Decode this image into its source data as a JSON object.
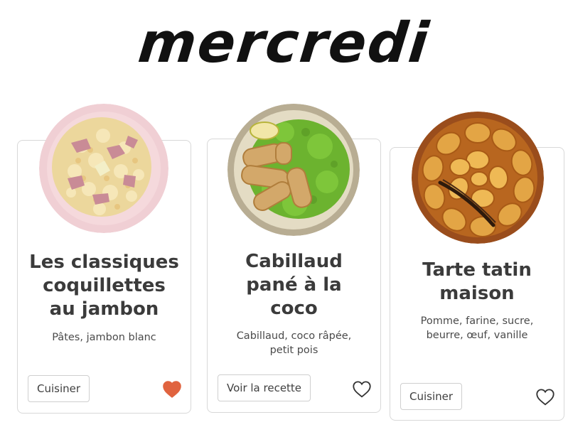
{
  "day": "mercredi",
  "recipes": [
    {
      "title_lines": [
        "Les classiques",
        "coquillettes",
        "au jambon"
      ],
      "ingredients_lines": [
        "Pâtes, jambon blanc"
      ],
      "button_label": "Cuisiner",
      "favorited": true,
      "heart_color": "#e0633f"
    },
    {
      "title_lines": [
        "Cabillaud",
        "pané à la",
        "coco"
      ],
      "ingredients_lines": [
        "Cabillaud, coco râpée,",
        "petit pois"
      ],
      "button_label": "Voir la recette",
      "favorited": false,
      "heart_color": "#333333"
    },
    {
      "title_lines": [
        "Tarte tatin",
        "maison"
      ],
      "ingredients_lines": [
        "Pomme, farine, sucre,",
        "beurre, œuf, vanille"
      ],
      "button_label": "Cuisiner",
      "favorited": false,
      "heart_color": "#333333"
    }
  ]
}
